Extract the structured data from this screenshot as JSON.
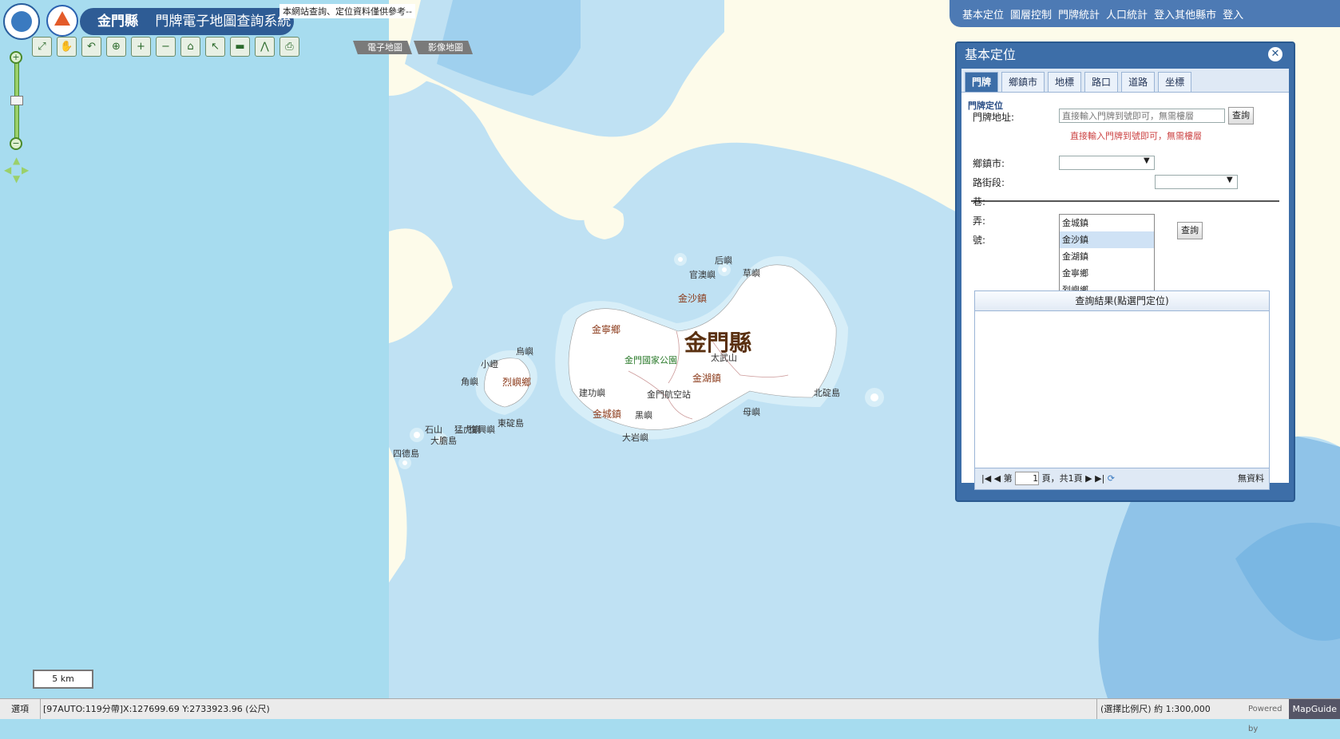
{
  "app": {
    "county": "金門縣",
    "system_title": "門牌電子地圖查詢系統"
  },
  "notice": "本網站查詢、定位資料僅供參考--",
  "map_tabs": [
    "電子地圖",
    "影像地圖"
  ],
  "top_menu": [
    "基本定位",
    "圖層控制",
    "門牌統計",
    "人口統計",
    "登入其他縣市",
    "登入"
  ],
  "map_labels": {
    "county": "金門縣",
    "towns": [
      "金沙鎮",
      "金寧鄉",
      "烈嶼鄉",
      "金湖鎮",
      "金城鎮"
    ],
    "places": [
      "官澳嶼",
      "后嶼",
      "草嶼",
      "小嶝",
      "烏嶼",
      "角嶼",
      "太武山",
      "金門國家公園",
      "金門航空站",
      "建功嶼",
      "北碇島",
      "母嶼",
      "東碇島",
      "復興嶼",
      "石山",
      "猛虎嶼",
      "大膽島",
      "四德島",
      "大岩嶼",
      "黑嶼"
    ]
  },
  "panel": {
    "title": "基本定位",
    "tabs": [
      "門牌",
      "鄉鎮市",
      "地標",
      "路口",
      "道路",
      "坐標"
    ],
    "active_tab": "門牌",
    "section_title": "門牌定位",
    "address_label": "門牌地址:",
    "address_placeholder": "直接輸入門牌到號即可，無需樓層",
    "query_button": "查詢",
    "hint": "直接輸入門牌到號即可，無需樓層",
    "town_label": "鄉鎮市:",
    "road_label": "路街段:",
    "lane_label": "巷:",
    "alley_label": "弄:",
    "number_label": "號:",
    "query_button2": "查詢",
    "town_options": [
      "金城鎮",
      "金沙鎮",
      "金湖鎮",
      "金寧鄉",
      "烈嶼鄉"
    ],
    "town_hover": "金沙鎮",
    "result_title": "查詢結果(點選門定位)",
    "pager": {
      "prefix": "第",
      "page": "1",
      "suffix": "頁，共1頁",
      "no_data": "無資料"
    }
  },
  "scale_bar": "5 km",
  "status": {
    "options": "選項",
    "coord": "[97AUTO:119分帶]X:127699.69 Y:2733923.96 (公尺)",
    "scale": "(選擇比例尺) 約 1:300,000",
    "powered": "Powered by",
    "brand": "MapGuide"
  },
  "colors": {
    "panel_blue": "#3d6ea8",
    "sea": "#bfe1f3",
    "land": "#fdfbea",
    "island": "#ffffff"
  }
}
